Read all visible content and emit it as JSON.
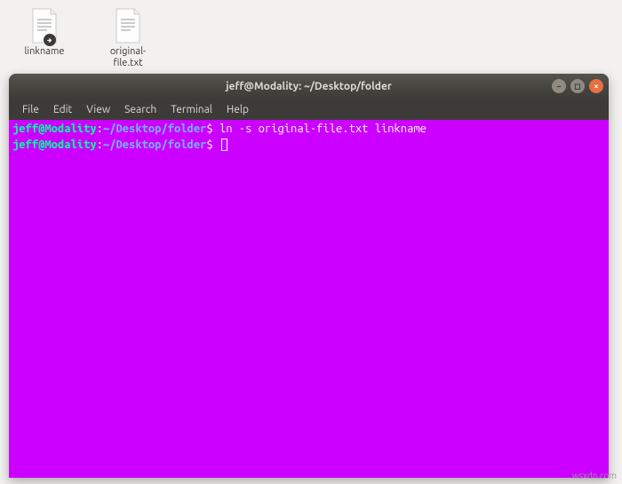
{
  "desktop": {
    "icons": [
      {
        "label": "linkname",
        "type": "symlink"
      },
      {
        "label": "original-file.txt",
        "type": "text"
      }
    ]
  },
  "window": {
    "title": "jeff@Modality: ~/Desktop/folder",
    "controls": {
      "minimize": "−",
      "maximize": "◻",
      "close": "×"
    }
  },
  "menu": {
    "items": [
      "File",
      "Edit",
      "View",
      "Search",
      "Terminal",
      "Help"
    ]
  },
  "terminal": {
    "lines": [
      {
        "user": "jeff@Modality",
        "sep1": ":",
        "path": "~/Desktop/folder",
        "prompt": "$",
        "command": " ln -s original-file.txt linkname"
      },
      {
        "user": "jeff@Modality",
        "sep1": ":",
        "path": "~/Desktop/folder",
        "prompt": "$",
        "command": " "
      }
    ]
  },
  "watermark": "wsxdn.com"
}
